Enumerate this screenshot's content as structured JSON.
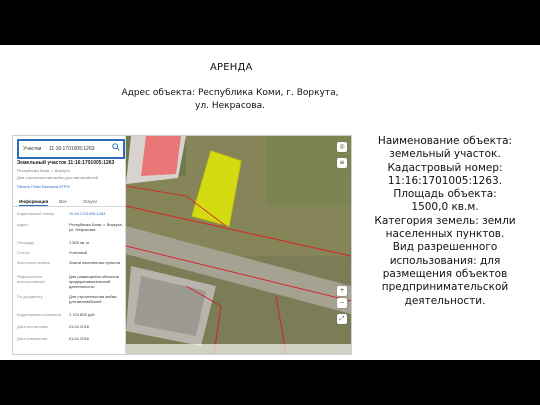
{
  "slide": {
    "title": "АРЕНДА",
    "address_line1": "Адрес объекта: Республика Коми, г. Воркута,",
    "address_line2": "ул. Некрасова.",
    "description": [
      "Наименование объекта:",
      "земельный участок.",
      "Кадастровый номер:",
      "11:16:1701005:1263.",
      "Площадь объекта:",
      "1500,0 кв.м.",
      "Категория земель: земли",
      "населенных пунктов.",
      "Вид разрешенного",
      "использования: для",
      "размещения объектов",
      "предпринимательской",
      "деятельности."
    ]
  },
  "panel": {
    "search_label": "Участки",
    "search_value": "11:16:1701005:1263",
    "heading": "Земельный участок 11:16:1701005:1263",
    "sub1": "Республика Коми, г. Воркута",
    "sub2": "Для строительства мойки для автомобилей",
    "links": "Печать  План  Выписка ЕГРН",
    "tab_info": "Информация",
    "tab_other": "Все",
    "tab_services": "Услуги",
    "rows": [
      {
        "k": "Кадастровый номер",
        "v": "11:16:1701005:1263"
      },
      {
        "k": "Адрес",
        "v": "Республика Коми, г. Воркута, ул. Некрасова"
      },
      {
        "k": "Площадь",
        "v": "1 500 кв. м"
      },
      {
        "k": "Статус",
        "v": "Учтенный"
      },
      {
        "k": "Категория земель",
        "v": "Земли населенных пунктов"
      },
      {
        "k": "Разрешенное использование",
        "v": "Для размещения объектов предпринимательской деятельности"
      },
      {
        "k": "По документу",
        "v": "Для строительства мойки для автомобилей"
      },
      {
        "k": "Кадастровая стоимость",
        "v": "1 724 800 руб."
      },
      {
        "k": "Дата постановки",
        "v": "01.01.2016"
      },
      {
        "k": "Дата изменения",
        "v": "01.01.2016"
      }
    ]
  },
  "map_buttons": [
    "+",
    "−",
    "◎",
    "⤢",
    "≡"
  ],
  "colors": {
    "accent": "#2a6ebd",
    "parcel_fill": "#e8f000",
    "boundary": "#d6242a",
    "road": "#9c9a8c"
  }
}
